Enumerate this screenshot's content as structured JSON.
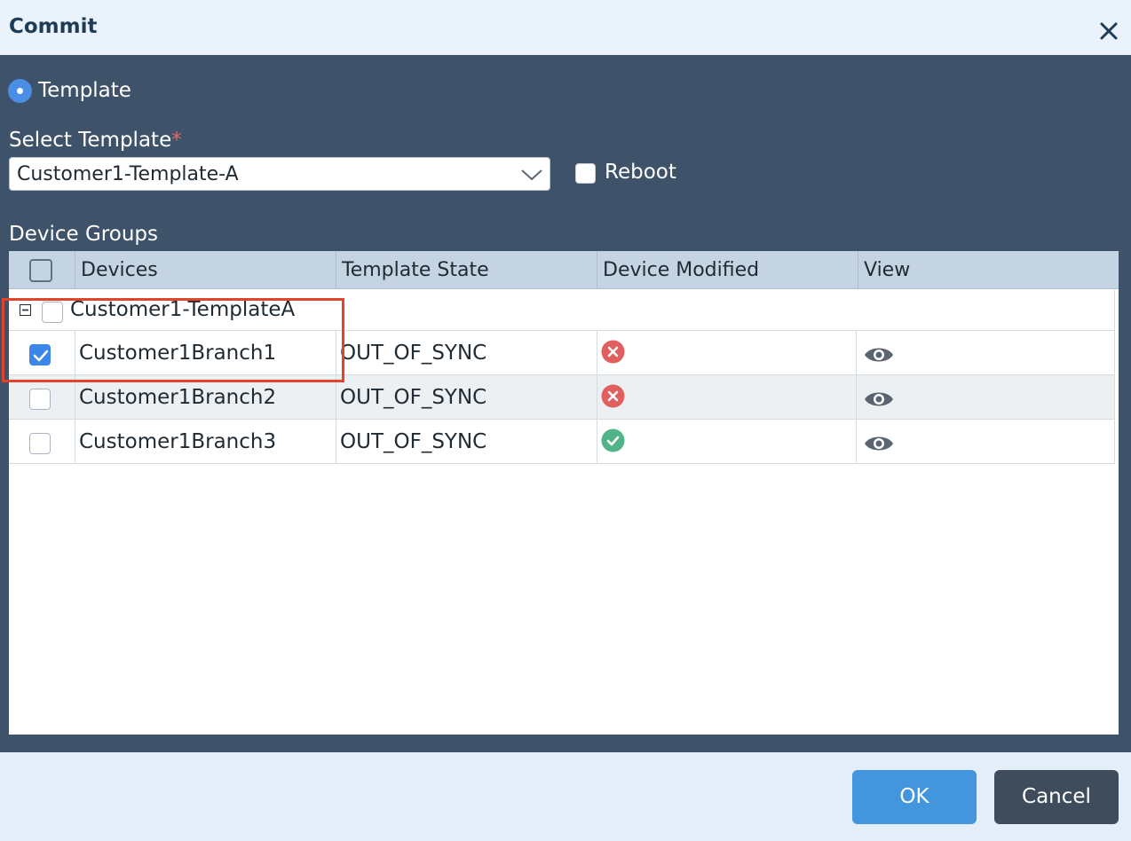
{
  "dialog": {
    "title": "Commit",
    "close_icon": "close-icon"
  },
  "mode": {
    "template_label": "Template",
    "template_selected": true
  },
  "select_template": {
    "label": "Select Template",
    "required_mark": "*",
    "value": "Customer1-Template-A"
  },
  "reboot": {
    "label": "Reboot",
    "checked": false
  },
  "device_groups": {
    "label": "Device Groups",
    "columns": [
      "Devices",
      "Template State",
      "Device Modified",
      "View"
    ],
    "group": {
      "name": "Customer1-TemplateA",
      "expanded": true,
      "checked": false
    },
    "rows": [
      {
        "device": "Customer1Branch1",
        "state": "OUT_OF_SYNC",
        "modified": "error-icon",
        "checked": true
      },
      {
        "device": "Customer1Branch2",
        "state": "OUT_OF_SYNC",
        "modified": "error-icon",
        "checked": false
      },
      {
        "device": "Customer1Branch3",
        "state": "OUT_OF_SYNC",
        "modified": "success-icon",
        "checked": false
      }
    ]
  },
  "footer": {
    "ok_label": "OK",
    "cancel_label": "Cancel"
  },
  "colors": {
    "accent": "#4395dd",
    "error": "#e05f5f",
    "success": "#52b38a",
    "highlight": "#e2432b"
  }
}
